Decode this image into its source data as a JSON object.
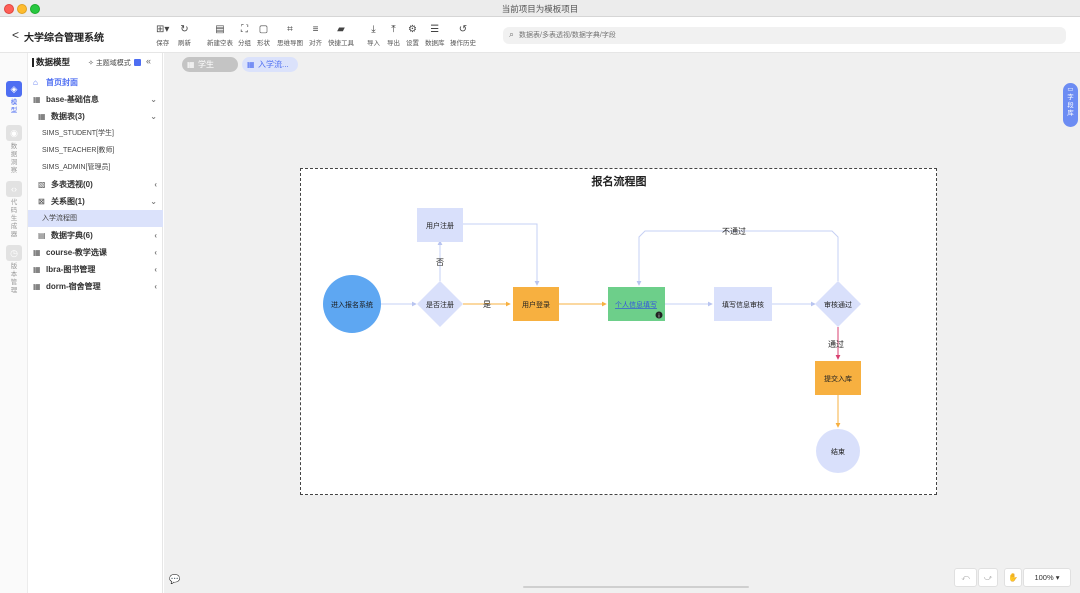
{
  "window": {
    "title": "当前项目为模板项目"
  },
  "header": {
    "back": "<",
    "app_title": "大学综合管理系统",
    "tools": [
      {
        "icon": "save-icon",
        "glyph": "⊞▾",
        "label": "保存"
      },
      {
        "icon": "refresh-icon",
        "glyph": "↻",
        "label": "刷新"
      },
      {
        "icon": "new-blank-table-icon",
        "glyph": "▤",
        "label": "新建空表"
      },
      {
        "icon": "group-icon",
        "glyph": "⛶",
        "label": "分组"
      },
      {
        "icon": "shape-icon",
        "glyph": "▢",
        "label": "形状"
      },
      {
        "icon": "mind-map-icon",
        "glyph": "⌗",
        "label": "思维导图"
      },
      {
        "icon": "align-icon",
        "glyph": "≡",
        "label": "对齐"
      },
      {
        "icon": "quick-tools-icon",
        "glyph": "▰",
        "label": "快捷工具"
      },
      {
        "icon": "import-icon",
        "glyph": "⤓",
        "label": "导入"
      },
      {
        "icon": "export-icon",
        "glyph": "⤒",
        "label": "导出"
      },
      {
        "icon": "settings-icon",
        "glyph": "⚙",
        "label": "设置"
      },
      {
        "icon": "database-icon",
        "glyph": "☰",
        "label": "数据库"
      },
      {
        "icon": "history-icon",
        "glyph": "↺",
        "label": "操作历史"
      }
    ],
    "search_placeholder": "数据表/多表透视/数据字典/字段"
  },
  "rail": [
    {
      "label": "模型",
      "active": true
    },
    {
      "label": "数据洞察",
      "active": false
    },
    {
      "label": "代码生成器",
      "active": false
    },
    {
      "label": "版本管理",
      "active": false
    }
  ],
  "tree": {
    "title": "数据模型",
    "theme_mode": "主题域模式",
    "collapse": "«",
    "items": [
      {
        "label": "首页封面",
        "level": 0,
        "icon": "home-icon",
        "glyph": "⌂"
      },
      {
        "label": "base-基础信息",
        "level": 0,
        "icon": "grid-icon",
        "glyph": "▦",
        "arrow": "⌄"
      },
      {
        "label": "数据表(3)",
        "level": 1,
        "icon": "table-icon",
        "glyph": "▦",
        "arrow": "⌄"
      },
      {
        "label": "SIMS_STUDENT[学生]",
        "level": 2
      },
      {
        "label": "SIMS_TEACHER[教师]",
        "level": 2
      },
      {
        "label": "SIMS_ADMIN[管理员]",
        "level": 2
      },
      {
        "label": "多表透视(0)",
        "level": 1,
        "icon": "pivot-icon",
        "glyph": "▧",
        "arrow": "‹"
      },
      {
        "label": "关系图(1)",
        "level": 1,
        "icon": "relation-icon",
        "glyph": "⊠",
        "arrow": "⌄"
      },
      {
        "label": "入学流程图",
        "level": 2
      },
      {
        "label": "数据字典(6)",
        "level": 1,
        "icon": "dictionary-icon",
        "glyph": "▤",
        "arrow": "‹"
      },
      {
        "label": "course-教学选课",
        "level": 0,
        "icon": "grid-icon",
        "glyph": "▦",
        "arrow": "‹"
      },
      {
        "label": "lbra-图书管理",
        "level": 0,
        "icon": "grid-icon",
        "glyph": "▦",
        "arrow": "‹"
      },
      {
        "label": "dorm-宿舍管理",
        "level": 0,
        "icon": "grid-icon",
        "glyph": "▦",
        "arrow": "‹"
      }
    ]
  },
  "tabs": [
    {
      "label": "学生"
    },
    {
      "label": "入学流..."
    }
  ],
  "dict_button": "字段库",
  "diagram": {
    "title": "报名流程图",
    "nodes": {
      "start": "进入报名系统",
      "registered_check": "是否注册",
      "register": "用户注册",
      "login": "用户登录",
      "personal_info": "个人信息填写",
      "fill_review": "填写信息审核",
      "review_pass": "审核通过",
      "submit": "提交入库",
      "end": "结束"
    },
    "edge_labels": {
      "no": "否",
      "yes": "是",
      "fail": "不通过",
      "pass": "通过"
    },
    "colors": {
      "blue_circle": "#5ea7f2",
      "lavender": "#d9e0fb",
      "orange": "#f7b040",
      "green": "#6dcf8a",
      "red_arrow": "#d94070",
      "orange_arrow": "#f7b040"
    }
  },
  "bottom": {
    "zoom": "100%",
    "undo": "⤺",
    "redo": "⤻",
    "hand": "✋",
    "comment": "💬"
  }
}
